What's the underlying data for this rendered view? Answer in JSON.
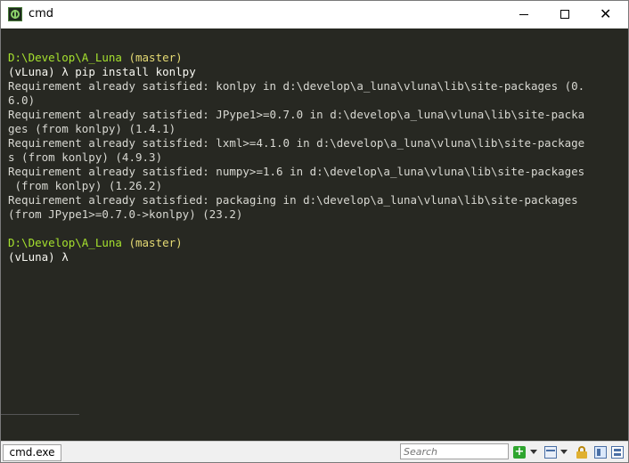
{
  "window": {
    "title": "cmd",
    "icon": "cmder-icon"
  },
  "titlebar_controls": {
    "minimize": "—",
    "maximize": "☐",
    "close": "✕"
  },
  "console": {
    "block1": {
      "path": "D:\\Develop\\A_Luna",
      "branch": "(master)",
      "prompt": "(vLuna) λ ",
      "command": "pip install konlpy"
    },
    "output": [
      "Requirement already satisfied: konlpy in d:\\develop\\a_luna\\vluna\\lib\\site-packages (0.",
      "6.0)",
      "Requirement already satisfied: JPype1>=0.7.0 in d:\\develop\\a_luna\\vluna\\lib\\site-packa",
      "ges (from konlpy) (1.4.1)",
      "Requirement already satisfied: lxml>=4.1.0 in d:\\develop\\a_luna\\vluna\\lib\\site-package",
      "s (from konlpy) (4.9.3)",
      "Requirement already satisfied: numpy>=1.6 in d:\\develop\\a_luna\\vluna\\lib\\site-packages",
      " (from konlpy) (1.26.2)",
      "Requirement already satisfied: packaging in d:\\develop\\a_luna\\vluna\\lib\\site-packages",
      "(from JPype1>=0.7.0->konlpy) (23.2)"
    ],
    "block2": {
      "path": "D:\\Develop\\A_Luna",
      "branch": "(master)",
      "prompt": "(vLuna) λ"
    }
  },
  "statusbar": {
    "tab_label": "cmd.exe",
    "search_placeholder": "Search",
    "new_console_glyph": "+",
    "colors": {
      "background": "#272822",
      "path": "#a6e22e",
      "branch": "#e6db74",
      "text": "#d8d8d2"
    }
  }
}
